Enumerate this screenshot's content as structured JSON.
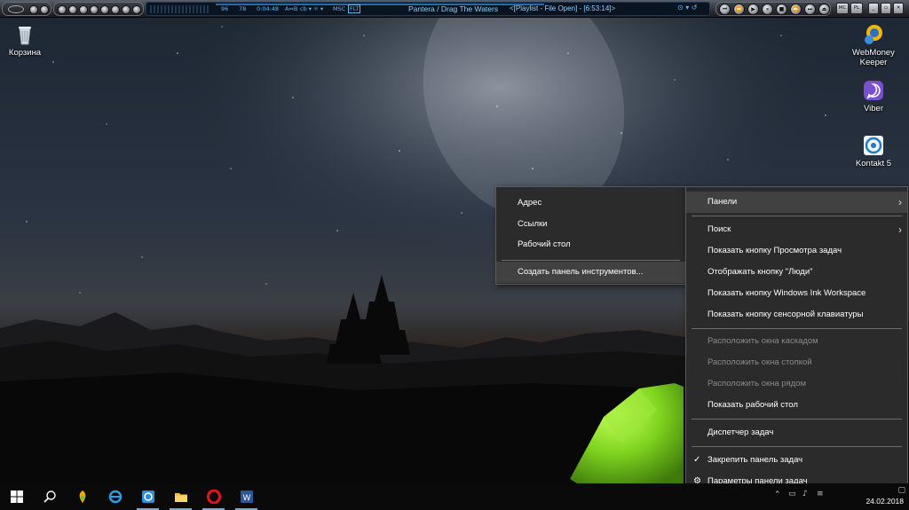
{
  "player": {
    "vol": "96",
    "bal": "78",
    "time": "0:04:48",
    "mode_ab": "A⇔B",
    "mode_cb": "cb ▾",
    "mode_3": "☼ ▾",
    "mode_4": "MSC",
    "mode_5": "FLT",
    "track_title": "Pantera / Drag The Waters",
    "playlist_info": "<[Playlist - File Open] - [6:53:14]>",
    "buttons": {
      "mc": "MC",
      "pl": "PL"
    }
  },
  "desktop": {
    "icons": [
      {
        "name": "recycle-bin",
        "label": "Корзина"
      },
      {
        "name": "webmoney",
        "label": "WebMoney Keeper"
      },
      {
        "name": "viber",
        "label": "Viber"
      },
      {
        "name": "kontakt",
        "label": "Kontakt 5"
      }
    ]
  },
  "toolbars_menu": {
    "items": [
      "Адрес",
      "Ссылки",
      "Рабочий стол"
    ],
    "new_toolbar": "Создать панель инструментов..."
  },
  "taskbar_menu": {
    "panels": "Панели",
    "search": "Поиск",
    "task_view": "Показать кнопку Просмотра задач",
    "people": "Отображать кнопку \"Люди\"",
    "ink": "Показать кнопку Windows Ink Workspace",
    "keyboard": "Показать кнопку сенсорной клавиатуры",
    "cascade": "Расположить окна каскадом",
    "stack": "Расположить окна стопкой",
    "side": "Расположить окна рядом",
    "show_desktop": "Показать рабочий стол",
    "task_manager": "Диспетчер задач",
    "lock": "Закрепить панель задач",
    "settings": "Параметры панели задач"
  },
  "taskbar": {
    "date": "24.02.2018",
    "apps": [
      "start",
      "search",
      "fl-studio",
      "ie",
      "media",
      "explorer",
      "opera",
      "word"
    ],
    "colors": {
      "accent": "#79a7d6",
      "bg": "#0a0a0a"
    }
  }
}
